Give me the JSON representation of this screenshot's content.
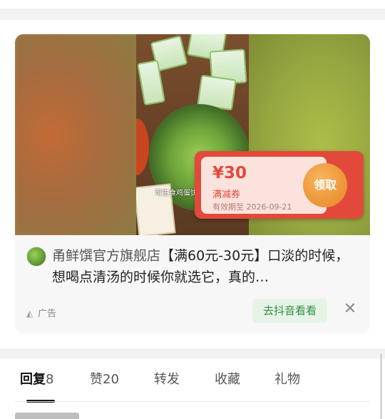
{
  "ad": {
    "coupon": {
      "price": "¥30",
      "type": "满减券",
      "valid": "有效期至 2026-09-21",
      "claim_label": "领取"
    },
    "video_subtitle": "可生食鸡蛋饼",
    "shop_name": "甬鲜馔官方旗舰店",
    "title": "【满60元-30元】口淡的时候，想喝点清汤的时候你就选它，真的…",
    "ad_label": "广告",
    "cta_label": "去抖音看看",
    "close_icon": "close-icon",
    "colors": {
      "coupon_red": "#e2493b",
      "claim_orange": "#ee9a3c",
      "cta_green": "#2f8f3e"
    }
  },
  "tabs": [
    {
      "label": "回复",
      "count": "8",
      "active": true
    },
    {
      "label": "赞",
      "count": "20",
      "active": false
    },
    {
      "label": "转发",
      "count": "",
      "active": false
    },
    {
      "label": "收藏",
      "count": "",
      "active": false
    },
    {
      "label": "礼物",
      "count": "",
      "active": false
    }
  ]
}
